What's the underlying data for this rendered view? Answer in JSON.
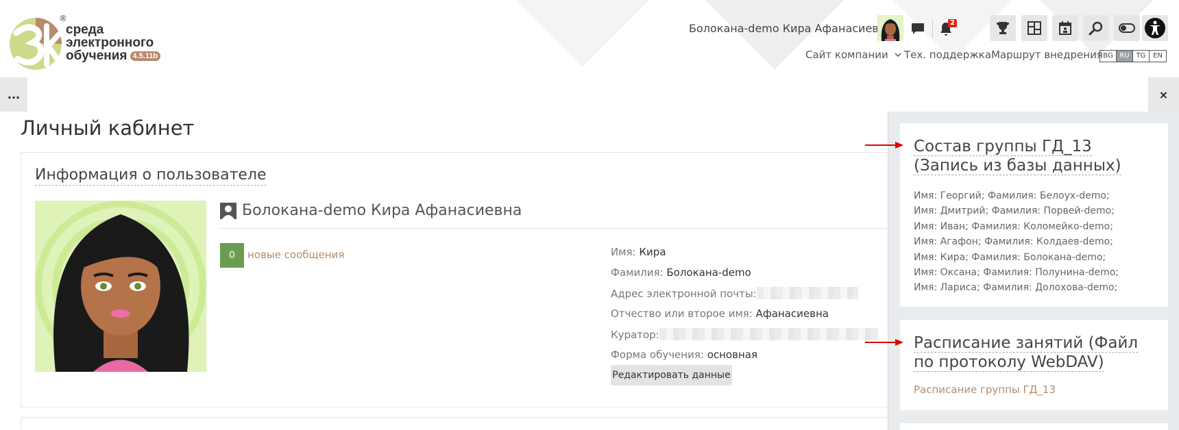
{
  "app": {
    "logo_line1": "среда",
    "logo_line2": "электронного",
    "logo_line3": "обучения",
    "version": "4.5.11b",
    "reg_mark": "®"
  },
  "header": {
    "user_name": "Болокана-demo Кира Афанасиевна",
    "notifications_count": "2",
    "nav": [
      {
        "label": "Сайт компании",
        "has_dropdown": true
      },
      {
        "label": "Тех. поддержка"
      },
      {
        "label": "Маршрут внедрения"
      }
    ],
    "languages": [
      "BG",
      "RU",
      "TG",
      "EN"
    ],
    "active_language": "RU",
    "more_label": "...",
    "close_label": "×"
  },
  "main": {
    "page_title": "Личный кабинет",
    "info_card": {
      "title": "Информация о пользователе",
      "full_name": "Болокана-demo Кира Афанасиевна",
      "new_messages_count": "0",
      "new_messages_label": "новые сообщения",
      "fields": {
        "first_name_label": "Имя:",
        "first_name": "Кира",
        "last_name_label": "Фамилия:",
        "last_name": "Болокана-demo",
        "email_label": "Адрес электронной почты:",
        "patronymic_label": "Отчество или второе имя:",
        "patronymic": "Афанасиевна",
        "curator_label": "Куратор:",
        "study_form_label": "Форма обучения:",
        "study_form": "основная"
      },
      "edit_label": "Редактировать данные"
    }
  },
  "drawer": {
    "group_block": {
      "title": "Состав группы ГД_13 (Запись из базы данных)",
      "members": [
        "Имя: Георгий; Фамилия: Белоух-demo;",
        "Имя: Дмитрий; Фамилия: Порвей-demo;",
        "Имя: Иван; Фамилия: Коломейко-demo;",
        "Имя: Агафон; Фамилия: Колдаев-demo;",
        "Имя: Кира; Фамилия: Болокана-demo;",
        "Имя: Оксана; Фамилия: Полунина-demo;",
        "Имя: Лариса; Фамилия: Долохова-demo;"
      ]
    },
    "schedule_block": {
      "title": "Расписание занятий (Файл по протоколу WebDAV)",
      "link": "Расписание группы ГД_13"
    }
  },
  "colors": {
    "accent_link": "#b38c6d",
    "message_badge": "#6a9d52",
    "notification_badge": "#d9261c",
    "annotation_arrow": "#e00000"
  },
  "icons": [
    "chat-icon",
    "bell-icon",
    "trophy-icon",
    "dashboard-icon",
    "calendar-icon",
    "search-icon",
    "toggle-icon",
    "accessibility-icon",
    "person-icon"
  ]
}
